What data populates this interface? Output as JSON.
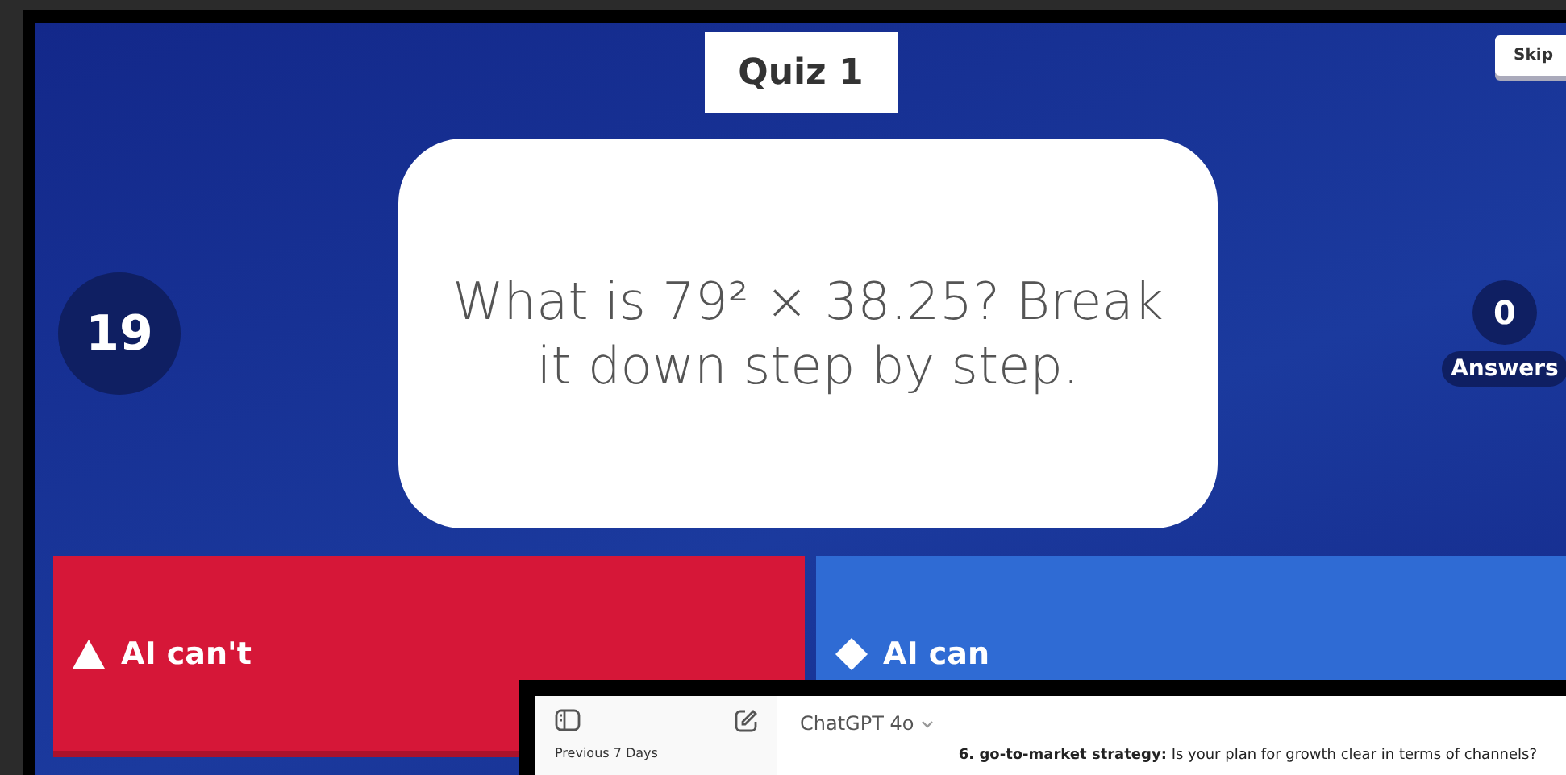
{
  "quiz": {
    "title": "Quiz 1",
    "skip": "Skip",
    "timer": "19",
    "answer_count": "0",
    "answers_label": "Answers",
    "question": "What is 79² × 38.25? Break it down step by step.",
    "choices": [
      {
        "kind": "triangle",
        "label": "AI can't",
        "color": "#d61738"
      },
      {
        "kind": "diamond",
        "label": "AI can",
        "color": "#2f6bd4"
      }
    ]
  },
  "chat_window": {
    "model": "ChatGPT 4o",
    "sidebar_heading": "Previous 7 Days",
    "message": "**6. go-to-market strategy:** Is your plan for growth clear in terms of channels?"
  }
}
